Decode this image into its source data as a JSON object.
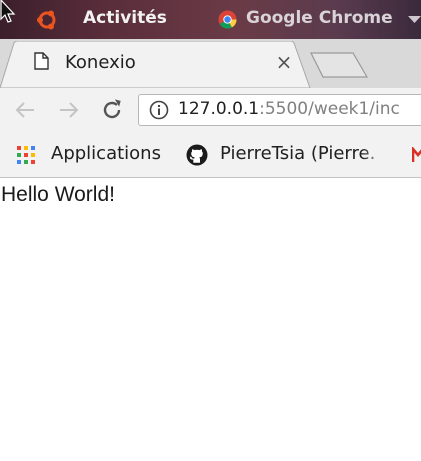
{
  "panel": {
    "activities_label": "Activités",
    "app_menu_label": "Google Chrome"
  },
  "tab": {
    "title": "Konexio",
    "close_symbol": "×"
  },
  "toolbar": {
    "url_host": "127.0.0.1",
    "url_path": ":5500/week1/inc"
  },
  "bookmarks": {
    "apps_label": "Applications",
    "github_label": "PierreTsia (Pierre."
  },
  "page": {
    "body_text": "Hello World!"
  },
  "icons": {
    "cursor": "mouse-pointer-icon",
    "ubuntu": "ubuntu-logo-icon",
    "chrome": "chrome-icon",
    "page": "page-icon",
    "back": "back-arrow-icon",
    "forward": "forward-arrow-icon",
    "reload": "reload-icon",
    "info": "info-icon",
    "apps": "apps-grid-icon",
    "github": "github-icon",
    "gmail": "gmail-icon"
  },
  "colors": {
    "panel_bg": "#5a2d3b",
    "tabstrip_bg": "#d9d9d9",
    "toolbar_bg": "#f2f2f2",
    "url_host": "#202020",
    "url_path": "#808080"
  }
}
